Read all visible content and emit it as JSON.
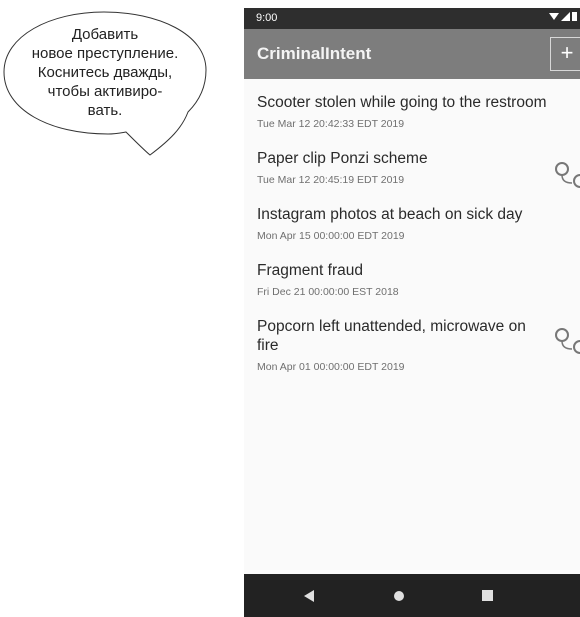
{
  "callout": {
    "lines": [
      "Добавить",
      "новое преступление.",
      "Коснитесь дважды,",
      "чтобы активиро-",
      "вать."
    ]
  },
  "status": {
    "time": "9:00"
  },
  "appbar": {
    "title": "CriminalIntent",
    "add_label": "+"
  },
  "crimes": [
    {
      "title": "Scooter stolen while going to the restroom",
      "date": "Tue Mar 12 20:42:33 EDT 2019",
      "solved": false
    },
    {
      "title": "Paper clip Ponzi scheme",
      "date": "Tue Mar 12 20:45:19 EDT 2019",
      "solved": true
    },
    {
      "title": "Instagram photos at beach on sick day",
      "date": "Mon Apr 15 00:00:00 EDT 2019",
      "solved": false
    },
    {
      "title": "Fragment fraud",
      "date": "Fri Dec 21 00:00:00 EST 2018",
      "solved": false
    },
    {
      "title": "Popcorn left unattended, microwave on fire",
      "date": "Mon Apr 01 00:00:00 EDT 2019",
      "solved": true
    }
  ],
  "icons": {
    "solved": "handcuffs-icon",
    "back": "back-triangle-icon",
    "home": "home-circle-icon",
    "recents": "recents-square-icon"
  },
  "colors": {
    "appbar": "#7d7d7d",
    "statusbar": "#2e2e2e",
    "navbar": "#222222"
  }
}
